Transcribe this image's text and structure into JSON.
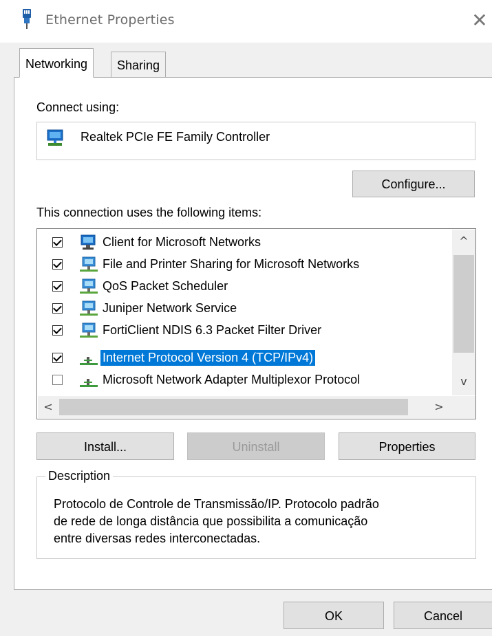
{
  "window": {
    "title": "Ethernet Properties",
    "close_glyph": "✕"
  },
  "tabs": [
    {
      "label": "Networking"
    },
    {
      "label": "Sharing"
    }
  ],
  "connect": {
    "label": "Connect using:",
    "adapter": "Realtek PCIe FE Family Controller",
    "icon": "network-adapter-icon"
  },
  "buttons": {
    "configure": "Configure...",
    "install": "Install...",
    "uninstall": "Uninstall",
    "properties": "Properties",
    "ok": "OK",
    "cancel": "Cancel"
  },
  "items_label": "This connection uses the following items:",
  "items": [
    {
      "label": "Client for Microsoft Networks",
      "checked": true,
      "icon": "client-icon",
      "selected": false
    },
    {
      "label": "File and Printer Sharing for Microsoft Networks",
      "checked": true,
      "icon": "service-icon",
      "selected": false
    },
    {
      "label": "QoS Packet Scheduler",
      "checked": true,
      "icon": "service-icon",
      "selected": false
    },
    {
      "label": "Juniper Network Service",
      "checked": true,
      "icon": "service-icon",
      "selected": false
    },
    {
      "label": "FortiClient NDIS 6.3 Packet Filter Driver",
      "checked": true,
      "icon": "service-icon",
      "selected": false
    },
    {
      "label": "Internet Protocol Version 4 (TCP/IPv4)",
      "checked": true,
      "icon": "protocol-icon",
      "selected": true
    },
    {
      "label": "Microsoft Network Adapter Multiplexor Protocol",
      "checked": false,
      "icon": "protocol-icon",
      "selected": false
    }
  ],
  "scroll": {
    "up": "^",
    "down": "v",
    "left": "<",
    "right": ">"
  },
  "description": {
    "legend": "Description",
    "lines": [
      "Protocolo de Controle de Transmissão/IP. Protocolo padrão",
      "de rede de longa distância que possibilita a comunicação",
      "entre diversas redes interconectadas."
    ]
  },
  "colors": {
    "selection": "#0078d7",
    "dialog_bg": "#f0f0f0",
    "button_bg": "#e1e1e1"
  }
}
